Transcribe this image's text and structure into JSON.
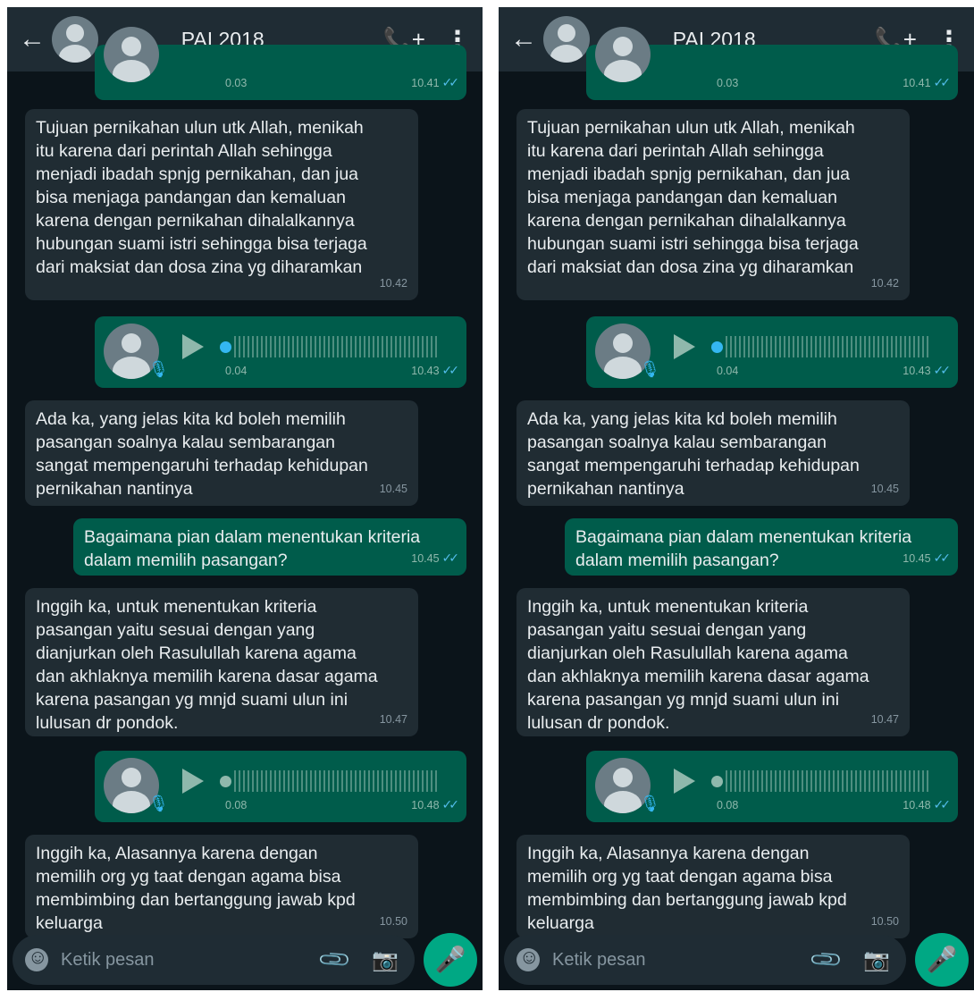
{
  "header": {
    "title": "PAI 2018",
    "back_icon": "←",
    "call_icon": "📞+",
    "more_icon": "⋮"
  },
  "partial_voice": {
    "duration": "0.03",
    "time": "10.41"
  },
  "msg1": {
    "text": "Tujuan pernikahan ulun utk Allah, menikah\nitu karena dari perintah Allah sehingga\nmenjadi ibadah spnjg pernikahan, dan jua\nbisa menjaga pandangan dan kemaluan\nkarena dengan pernikahan dihalalkannya\nhubungan suami istri sehingga bisa terjaga\ndari maksiat dan dosa zina yg diharamkan",
    "time": "10.42"
  },
  "voice1": {
    "duration": "0.04",
    "time": "10.43"
  },
  "msg2": {
    "text": "Ada ka, yang jelas kita kd boleh memilih\npasangan soalnya kalau sembarangan\nsangat mempengaruhi terhadap kehidupan\npernikahan nantinya",
    "time": "10.45"
  },
  "msg3": {
    "text": "Bagaimana pian dalam menentukan kriteria\ndalam memilih pasangan?",
    "time": "10.45"
  },
  "msg4": {
    "text": "Inggih ka, untuk menentukan kriteria\npasangan yaitu sesuai dengan yang\ndianjurkan oleh Rasulullah karena agama\ndan akhlaknya memilih karena dasar agama\nkarena pasangan yg mnjd suami ulun ini\nlulusan dr pondok.",
    "time": "10.47"
  },
  "voice2": {
    "duration": "0.08",
    "time": "10.48"
  },
  "msg5": {
    "text": "Inggih ka, Alasannya karena dengan\nmemilih org yg taat dengan agama bisa\nmembimbing dan bertanggung jawab kpd\nkeluarga",
    "time": "10.50"
  },
  "input": {
    "placeholder": "Ketik pesan"
  },
  "colors": {
    "background": "#0b141a",
    "incoming": "#202c33",
    "outgoing": "#005c4b",
    "accent": "#00a884",
    "read_ticks": "#53bdeb"
  }
}
